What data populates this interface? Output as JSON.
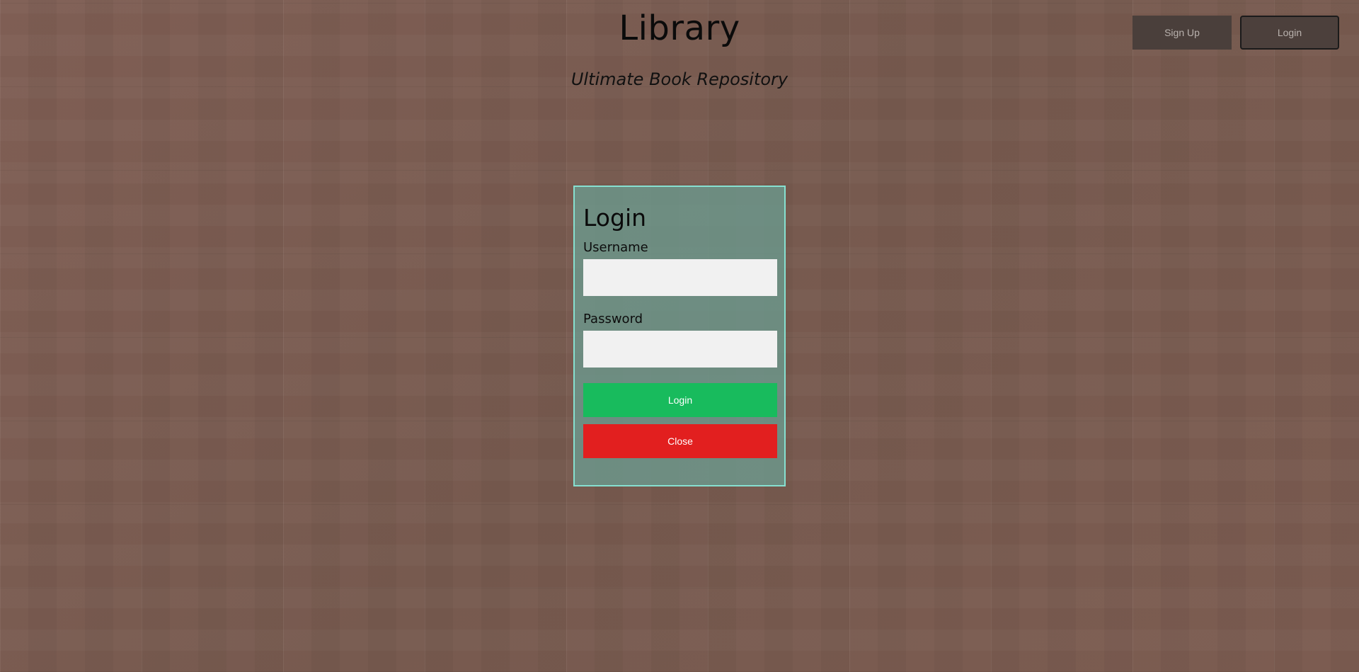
{
  "header": {
    "title": "Library",
    "subtitle": "Ultimate Book Repository"
  },
  "nav": {
    "signup_label": "Sign Up",
    "login_label": "Login"
  },
  "login_modal": {
    "title": "Login",
    "username_label": "Username",
    "username_value": "",
    "password_label": "Password",
    "password_value": "",
    "login_button": "Login",
    "close_button": "Close"
  },
  "colors": {
    "background": "#7a5a50",
    "modal_bg": "#6b9e92",
    "modal_border": "#86e0d0",
    "login_button": "#18bb5d",
    "close_button": "#e21f1f",
    "nav_button": "#4a3f3b"
  }
}
